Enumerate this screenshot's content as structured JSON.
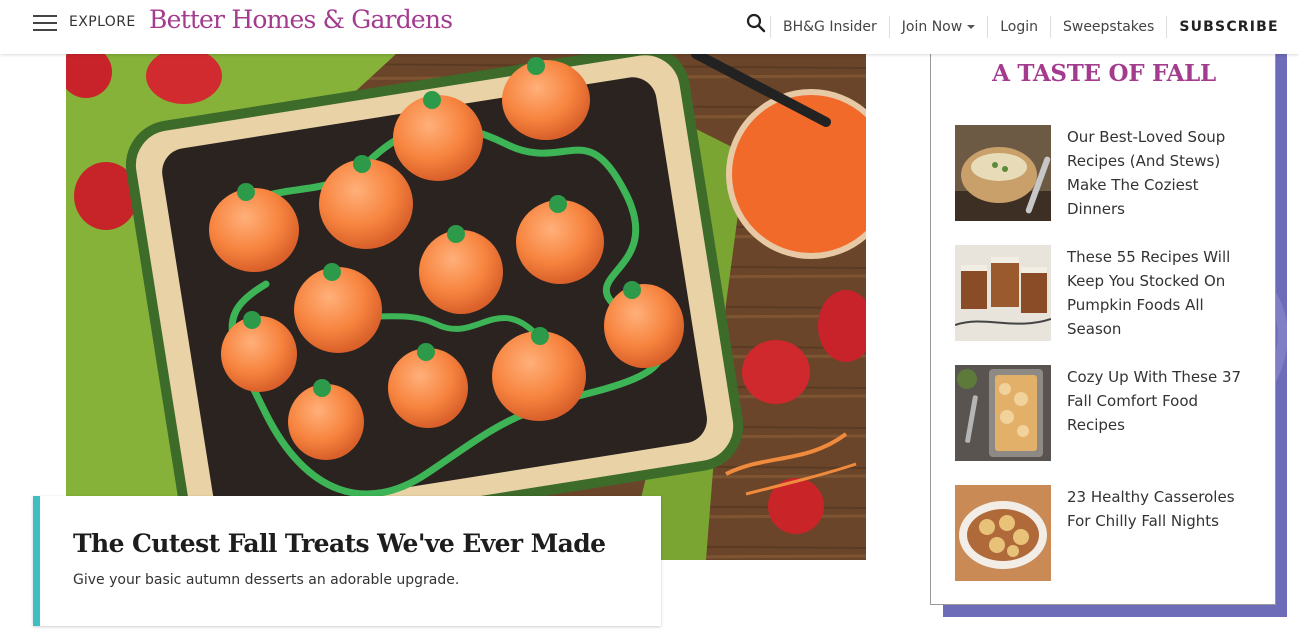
{
  "header": {
    "menu_label": "EXPLORE",
    "logo": "Better Homes & Gardens",
    "nav": {
      "insider": "BH&G Insider",
      "join": "Join Now",
      "login": "Login",
      "sweepstakes": "Sweepstakes",
      "subscribe": "SUBSCRIBE"
    },
    "icons": {
      "menu": "hamburger-icon",
      "search": "search-icon",
      "join_caret": "caret-down-icon"
    }
  },
  "hero": {
    "image_alt": "Pumpkin-shaped cake pops in a dirt dessert pan",
    "title": "The Cutest Fall Treats We've Ever Made",
    "subtitle": "Give your basic autumn desserts an adorable upgrade."
  },
  "sidebar": {
    "title": "A TASTE OF FALL",
    "items": [
      {
        "title": "Our Best-Loved Soup Recipes (And Stews) Make The Coziest Dinners"
      },
      {
        "title": "These 55 Recipes Will Keep You Stocked On Pumpkin Foods All Season"
      },
      {
        "title": "Cozy Up With These 37 Fall Comfort Food Recipes"
      },
      {
        "title": "23 Healthy Casseroles For Chilly Fall Nights"
      }
    ]
  },
  "colors": {
    "brand": "#a33b8e",
    "card_accent": "#3fbdc1",
    "sidebar_bg": "#6d6cb8"
  }
}
